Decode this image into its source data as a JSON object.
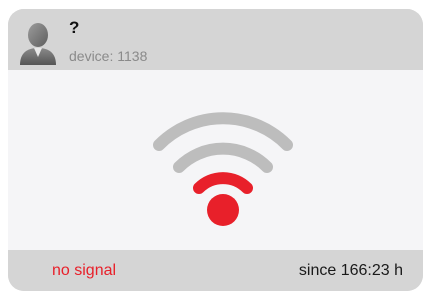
{
  "device_card": {
    "name": "?",
    "device": "device: 1138",
    "status": "no signal",
    "since": "since 166:23 h"
  },
  "icons": {
    "avatar": "user-avatar-icon",
    "signal": "wifi-signal-icon"
  },
  "colors": {
    "status_error": "#e8202a",
    "wifi_inactive": "#bdbdbd",
    "card_bar": "#d5d5d5",
    "card_body": "#f5f5f7"
  }
}
